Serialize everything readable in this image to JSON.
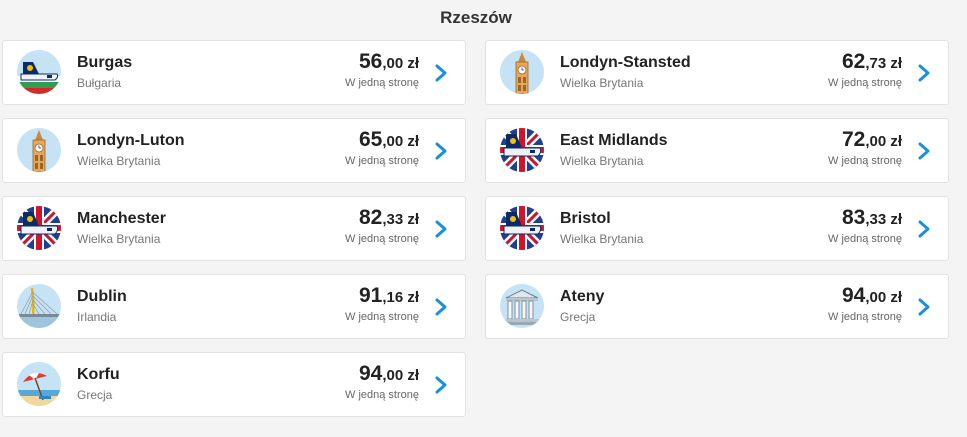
{
  "header": {
    "title": "Rzeszów"
  },
  "colors": {
    "accent": "#1a8fe0",
    "icon_bg": "#c6e3f6"
  },
  "destinations": [
    {
      "city": "Burgas",
      "country": "Bułgaria",
      "price_int": "56",
      "price_dec": ",00 zł",
      "oneway": "W jedną stronę",
      "icon": "ryanair-plane-bulgaria-flag-icon"
    },
    {
      "city": "Londyn-Stansted",
      "country": "Wielka Brytania",
      "price_int": "62",
      "price_dec": ",73 zł",
      "oneway": "W jedną stronę",
      "icon": "big-ben-icon"
    },
    {
      "city": "Londyn-Luton",
      "country": "Wielka Brytania",
      "price_int": "65",
      "price_dec": ",00 zł",
      "oneway": "W jedną stronę",
      "icon": "big-ben-icon"
    },
    {
      "city": "East Midlands",
      "country": "Wielka Brytania",
      "price_int": "72",
      "price_dec": ",00 zł",
      "oneway": "W jedną stronę",
      "icon": "ryanair-plane-uk-flag-icon"
    },
    {
      "city": "Manchester",
      "country": "Wielka Brytania",
      "price_int": "82",
      "price_dec": ",33 zł",
      "oneway": "W jedną stronę",
      "icon": "ryanair-plane-uk-flag-icon"
    },
    {
      "city": "Bristol",
      "country": "Wielka Brytania",
      "price_int": "83",
      "price_dec": ",33 zł",
      "oneway": "W jedną stronę",
      "icon": "ryanair-plane-uk-flag-icon"
    },
    {
      "city": "Dublin",
      "country": "Irlandia",
      "price_int": "91",
      "price_dec": ",16 zł",
      "oneway": "W jedną stronę",
      "icon": "samuel-beckett-bridge-icon"
    },
    {
      "city": "Ateny",
      "country": "Grecja",
      "price_int": "94",
      "price_dec": ",00 zł",
      "oneway": "W jedną stronę",
      "icon": "greek-temple-icon"
    },
    {
      "city": "Korfu",
      "country": "Grecja",
      "price_int": "94",
      "price_dec": ",00 zł",
      "oneway": "W jedną stronę",
      "icon": "beach-umbrella-icon"
    }
  ]
}
